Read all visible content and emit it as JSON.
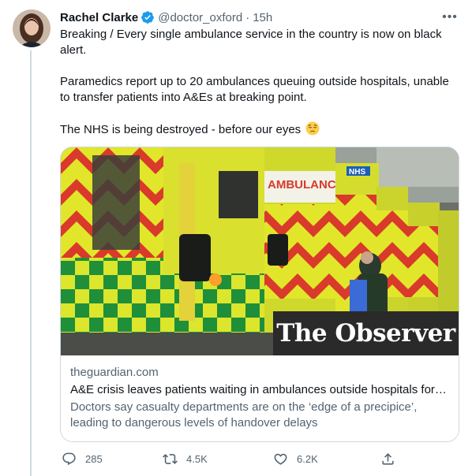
{
  "tweet": {
    "author_name": "Rachel Clarke",
    "handle": "@doctor_oxford",
    "separator": "·",
    "time": "15h",
    "paragraphs": [
      "Breaking / Every single ambulance service in the country is now on black alert.",
      "Paramedics report up to 20 ambulances queuing outside hospitals, unable to transfer patients into A&Es at breaking point.",
      "The NHS is being destroyed - before our eyes"
    ],
    "emoji": "pensive-face"
  },
  "card": {
    "brand_overlay": "The Observer",
    "image_signs": [
      "AMBULANCE",
      "NHS"
    ],
    "domain": "theguardian.com",
    "title": "A&E crisis leaves patients waiting in ambulances outside hospitals for …",
    "description": "Doctors say casualty departments are on the ‘edge of a precipice’, leading to dangerous levels of handover delays"
  },
  "actions": {
    "reply_count": "285",
    "retweet_count": "4.5K",
    "like_count": "6.2K"
  },
  "colors": {
    "text_primary": "#0f1419",
    "text_secondary": "#536471",
    "verified_blue": "#1d9bf0",
    "border": "#cfd9de",
    "ambulance_yellow": "#d8e52a",
    "ambulance_green": "#1f8f3a",
    "chevron_red": "#d93a2b"
  }
}
